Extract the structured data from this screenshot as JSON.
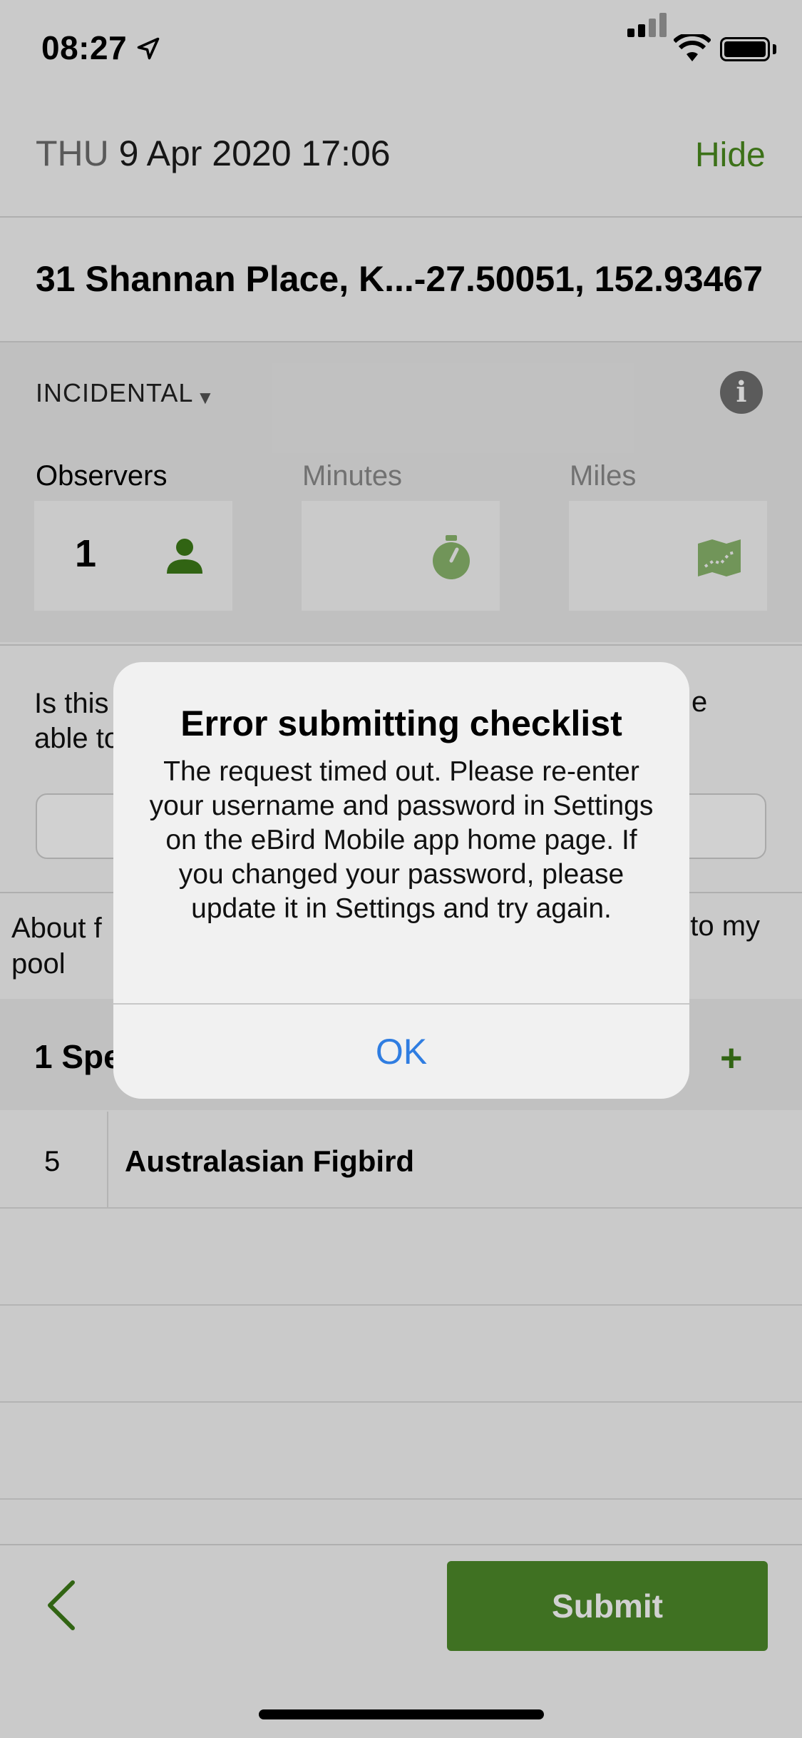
{
  "status_bar": {
    "time": "08:27"
  },
  "header": {
    "day": "THU",
    "date_time": "9 Apr 2020 17:06",
    "hide_label": "Hide"
  },
  "location": {
    "text": "31 Shannan Place, K...-27.50051, 152.93467"
  },
  "protocol": {
    "label": "INCIDENTAL",
    "caret": "▼",
    "info_icon": "info-icon"
  },
  "fields": {
    "observers": {
      "label": "Observers",
      "value": "1",
      "icon": "person-icon"
    },
    "minutes": {
      "label": "Minutes",
      "value": "",
      "icon": "timer-icon"
    },
    "miles": {
      "label": "Miles",
      "value": "",
      "icon": "map-icon"
    }
  },
  "complete_question": {
    "line1": "Is this",
    "line2": "able to",
    "tail": "e"
  },
  "comments": {
    "line1": "About f",
    "line2": "pool",
    "tail": "t to my"
  },
  "species_header": {
    "title": "1 Spe",
    "add_label": "+"
  },
  "species": [
    {
      "count": "5",
      "name": "Australasian Figbird"
    }
  ],
  "toolbar": {
    "back_icon": "chevron-left-icon",
    "submit_label": "Submit"
  },
  "alert": {
    "title": "Error submitting checklist",
    "message": "The request timed out. Please re-enter your username and password in Settings on the eBird Mobile app home page. If you changed your password, please update it in Settings and try again.",
    "ok_label": "OK"
  },
  "colors": {
    "accent_green": "#4e8a2a",
    "link_blue": "#2f7de1"
  }
}
